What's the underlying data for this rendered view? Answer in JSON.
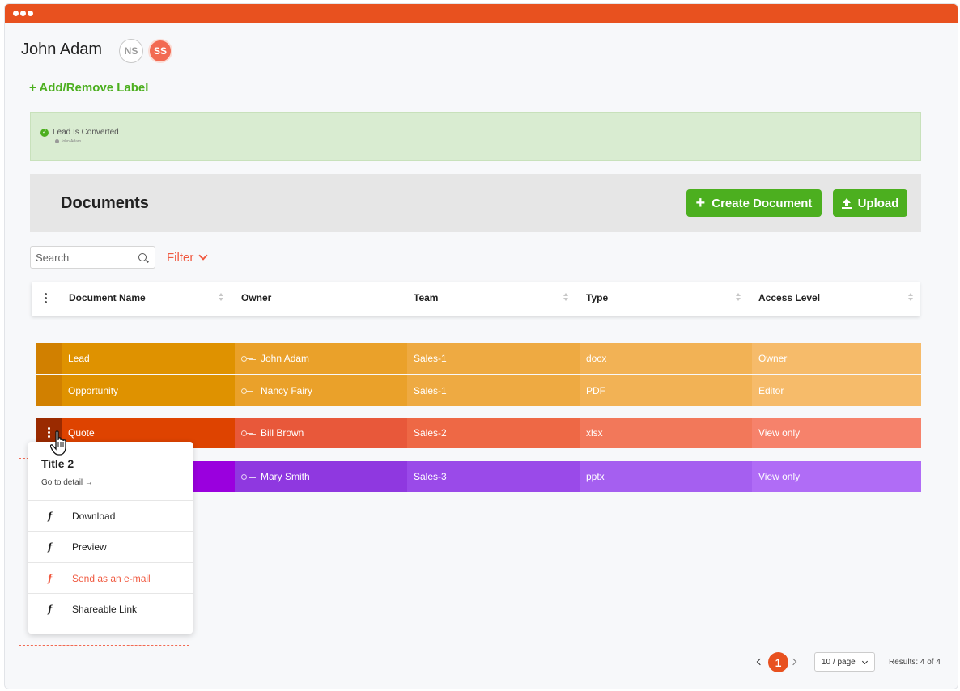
{
  "header": {
    "title": "John Adam",
    "avatars": [
      "NS",
      "SS"
    ],
    "add_label": "+ Add/Remove Label"
  },
  "banner": {
    "text": "Lead Is Converted",
    "user": "John Adam"
  },
  "documents": {
    "title": "Documents",
    "create_label": "Create Document",
    "upload_label": "Upload"
  },
  "search": {
    "placeholder": "Search"
  },
  "filter": {
    "label": "Filter"
  },
  "columns": [
    "Document Name",
    "Owner",
    "Team",
    "Type",
    "Access Level"
  ],
  "rows": [
    {
      "name": "Lead",
      "owner": "John Adam",
      "team": "Sales-1",
      "type": "docx",
      "access": "Owner",
      "colors": [
        "#d18000",
        "#df9200",
        "#eaa12a",
        "#eeaa42",
        "#f2b255",
        "#f6bb6a"
      ]
    },
    {
      "name": "Opportunity",
      "owner": "Nancy Fairy",
      "team": "Sales-1",
      "type": "PDF",
      "access": "Editor",
      "colors": [
        "#d18000",
        "#df9200",
        "#eaa12a",
        "#eeaa42",
        "#f2b255",
        "#f6bb6a"
      ]
    },
    {
      "name": "Quote",
      "owner": "Bill Brown",
      "team": "Sales-2",
      "type": "xlsx",
      "access": "View only",
      "colors": [
        "#9a2a00",
        "#de4300",
        "#e8583a",
        "#ee6845",
        "#f2785a",
        "#f6826b"
      ]
    },
    {
      "name": "",
      "owner": "Mary Smith",
      "team": "Sales-3",
      "type": "pptx",
      "access": "View only",
      "colors": [
        "#8600c8",
        "#9a00de",
        "#8f38e0",
        "#9a4ae9",
        "#a55ff0",
        "#b06cf6"
      ]
    }
  ],
  "menu": {
    "title": "Title 2",
    "detail": "Go to detail →",
    "items": [
      "Download",
      "Preview",
      "Send as an e-mail",
      "Shareable Link"
    ]
  },
  "pagination": {
    "page": "1",
    "per_page": "10 / page",
    "results": "Results: 4 of 4"
  }
}
